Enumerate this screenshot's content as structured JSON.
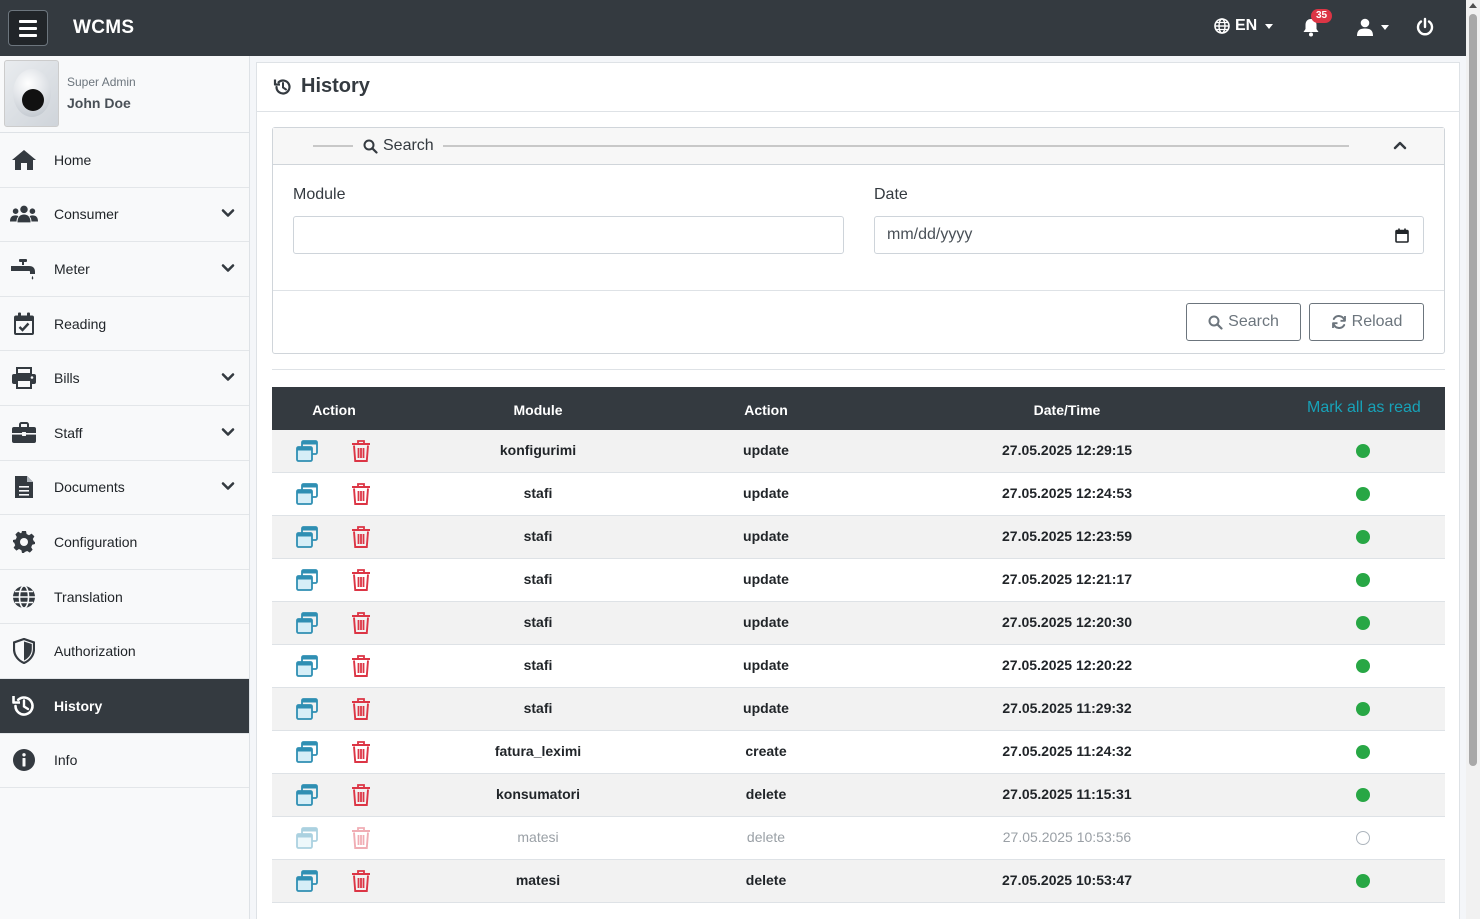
{
  "app": {
    "brand": "WCMS",
    "language": "EN",
    "notification_count": "35"
  },
  "user": {
    "role": "Super Admin",
    "name": "John Doe"
  },
  "sidebar": {
    "items": [
      {
        "label": "Home",
        "icon": "home-icon",
        "has_children": false
      },
      {
        "label": "Consumer",
        "icon": "users-icon",
        "has_children": true
      },
      {
        "label": "Meter",
        "icon": "faucet-icon",
        "has_children": true
      },
      {
        "label": "Reading",
        "icon": "calendar-check-icon",
        "has_children": false
      },
      {
        "label": "Bills",
        "icon": "printer-icon",
        "has_children": true
      },
      {
        "label": "Staff",
        "icon": "briefcase-icon",
        "has_children": true
      },
      {
        "label": "Documents",
        "icon": "file-icon",
        "has_children": true
      },
      {
        "label": "Configuration",
        "icon": "gear-icon",
        "has_children": false
      },
      {
        "label": "Translation",
        "icon": "globe-icon",
        "has_children": false
      },
      {
        "label": "Authorization",
        "icon": "shield-icon",
        "has_children": false
      },
      {
        "label": "History",
        "icon": "history-icon",
        "has_children": false,
        "active": true
      },
      {
        "label": "Info",
        "icon": "info-icon",
        "has_children": false
      }
    ]
  },
  "page": {
    "title": "History"
  },
  "search": {
    "legend": "Search",
    "module_label": "Module",
    "module_value": "",
    "date_label": "Date",
    "date_placeholder": "mm/dd/yyyy",
    "search_button": "Search",
    "reload_button": "Reload"
  },
  "table": {
    "headers": {
      "action": "Action",
      "module": "Module",
      "action2": "Action",
      "datetime": "Date/Time"
    },
    "mark_all_label": "Mark all as read",
    "rows": [
      {
        "module": "konfigurimi",
        "action": "update",
        "datetime": "27.05.2025 12:29:15",
        "read": false
      },
      {
        "module": "stafi",
        "action": "update",
        "datetime": "27.05.2025 12:24:53",
        "read": false
      },
      {
        "module": "stafi",
        "action": "update",
        "datetime": "27.05.2025 12:23:59",
        "read": false
      },
      {
        "module": "stafi",
        "action": "update",
        "datetime": "27.05.2025 12:21:17",
        "read": false
      },
      {
        "module": "stafi",
        "action": "update",
        "datetime": "27.05.2025 12:20:30",
        "read": false
      },
      {
        "module": "stafi",
        "action": "update",
        "datetime": "27.05.2025 12:20:22",
        "read": false
      },
      {
        "module": "stafi",
        "action": "update",
        "datetime": "27.05.2025 11:29:32",
        "read": false
      },
      {
        "module": "fatura_leximi",
        "action": "create",
        "datetime": "27.05.2025 11:24:32",
        "read": false
      },
      {
        "module": "konsumatori",
        "action": "delete",
        "datetime": "27.05.2025 11:15:31",
        "read": false
      },
      {
        "module": "matesi",
        "action": "delete",
        "datetime": "27.05.2025 10:53:56",
        "read": true
      },
      {
        "module": "matesi",
        "action": "delete",
        "datetime": "27.05.2025 10:53:47",
        "read": false
      }
    ]
  },
  "colors": {
    "navbar": "#343a40",
    "accent": "#17a2b8",
    "danger": "#dc3545",
    "success": "#28a745"
  }
}
